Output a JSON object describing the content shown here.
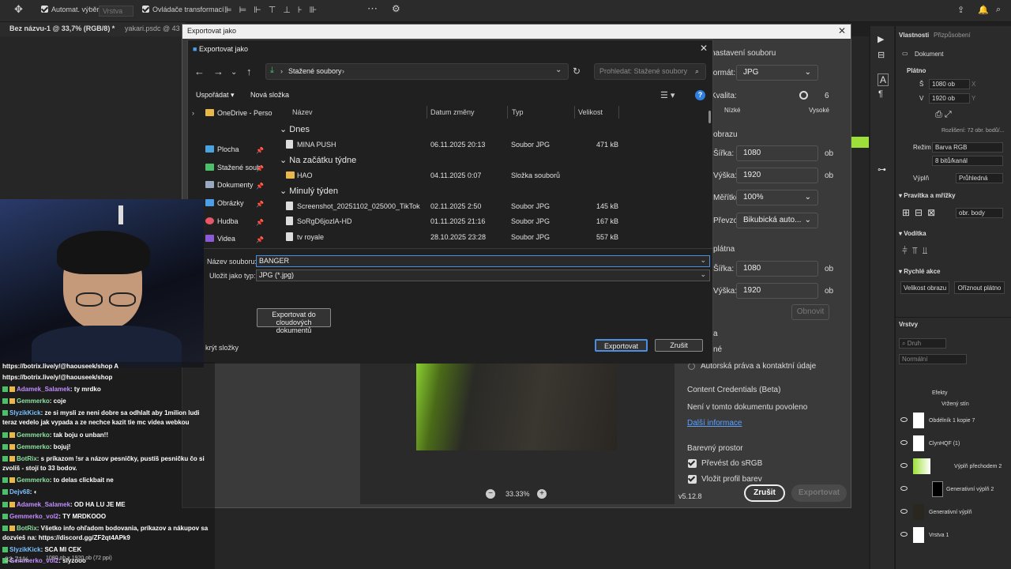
{
  "topbar": {
    "auto_select": "Automat. výběr",
    "layer_dropdown": "Vrstva",
    "transform_controls": "Ovládače transformací"
  },
  "tabs": [
    {
      "label": "Bez názvu-1 @ 33,7% (RGB/8) *"
    },
    {
      "label": "yakari.psdc @ 43"
    }
  ],
  "outer_dialog": {
    "title": "Exportovat jako",
    "file_settings_header": "nastavení souboru",
    "format_label": "formát:",
    "format_value": "JPG",
    "quality_label": "Kvalita:",
    "quality_value": "6",
    "quality_low": "Nízké",
    "quality_high": "Vysoké",
    "image_size_header": "obrazu",
    "width_label": "Šířka:",
    "width_value": "1080",
    "height_label": "Výška:",
    "height_value": "1920",
    "scale_label": "Měřítko:",
    "scale_value": "100%",
    "resample_label": "Převzorkovat:",
    "resample_value": "Bikubická auto...",
    "unit": "ob",
    "canvas_header": "plátna",
    "canvas_width_value": "1080",
    "canvas_height_value": "1920",
    "reset_button": "Obnovit",
    "metadata_partial_1": "a",
    "metadata_partial_2": "né",
    "copyright_label": "Autorská práva a kontaktní údaje",
    "content_credentials_title": "Content Credentials (Beta)",
    "content_credentials_text": "Není v tomto dokumentu povoleno",
    "more_info_link": "Další informace",
    "color_space_title": "Barevný prostor",
    "convert_srgb": "Převést do sRGB",
    "embed_profile": "Vložit profil barev",
    "version": "v5.12.8",
    "zoom": "33.33%",
    "cancel_button": "Zrušit",
    "export_button": "Exportovat"
  },
  "save_dialog": {
    "title": "Exportovat jako",
    "breadcrumb": "Stažené soubory",
    "search_placeholder": "Prohledat: Stažené soubory",
    "organize": "Uspořádat",
    "new_folder": "Nová složka",
    "nav": [
      {
        "label": "OneDrive - Perso",
        "color": "#e8b84a"
      },
      {
        "label": "Plocha",
        "color": "#4aa3df"
      },
      {
        "label": "Stažené soub",
        "color": "#4cbf6a"
      },
      {
        "label": "Dokumenty",
        "color": "#9aa8c0"
      },
      {
        "label": "Obrázky",
        "color": "#4a9fe8"
      },
      {
        "label": "Hudba",
        "color": "#e8566a"
      },
      {
        "label": "Videa",
        "color": "#8a5ad8"
      }
    ],
    "columns": {
      "name": "Název",
      "date": "Datum změny",
      "type": "Typ",
      "size": "Velikost"
    },
    "groups": [
      {
        "label": "Dnes"
      },
      {
        "label": "Na začátku týdne"
      },
      {
        "label": "Minulý týden"
      }
    ],
    "files": [
      {
        "name": "MINA PUSH",
        "date": "06.11.2025 20:13",
        "type": "Soubor JPG",
        "size": "471 kB"
      },
      {
        "name": "HAO",
        "date": "04.11.2025 0:07",
        "type": "Složka souborů",
        "size": ""
      },
      {
        "name": "Screenshot_20251102_025000_TikTok",
        "date": "02.11.2025 2:50",
        "type": "Soubor JPG",
        "size": "145 kB"
      },
      {
        "name": "SoRgD6jozlA-HD",
        "date": "01.11.2025 21:16",
        "type": "Soubor JPG",
        "size": "167 kB"
      },
      {
        "name": "tv royale",
        "date": "28.10.2025 23:28",
        "type": "Soubor JPG",
        "size": "557 kB"
      }
    ],
    "filename_label": "Název souboru:",
    "filename_value": "BANGER",
    "filetype_label": "Uložit jako typ:",
    "filetype_value": "JPG (*.jpg)",
    "cloud_button_line1": "Exportovat do",
    "cloud_button_line2": "cloudových dokumentů",
    "hide_folders": "krýt složky",
    "export_button": "Exportovat",
    "cancel_button": "Zrušit"
  },
  "right_panel": {
    "tab_properties": "Vlastnosti",
    "tab_adjustments": "Přizpůsobení",
    "document_label": "Dokument",
    "canvas_label": "Plátno",
    "w_label": "Š",
    "w_value": "1080 ob",
    "h_label": "V",
    "h_value": "1920 ob",
    "x_label": "X",
    "y_label": "Y",
    "resolution": "Rozlišení: 72 obr. bodů/...",
    "mode_label": "Režim",
    "mode_value": "Barva RGB",
    "bits_value": "8 bitů/kanál",
    "fill_label": "Výplň",
    "fill_value": "Průhledná",
    "rulers_label": "Pravítka a mřížky",
    "units_value": "obr. body",
    "guides_label": "Vodítka",
    "quick_actions_label": "Rychlé akce",
    "image_size_btn": "Velikost obrazu",
    "crop_btn": "Oříznout plátno",
    "layers_tab": "Vrstvy",
    "search_kind": "Druh",
    "blend_mode": "Normální",
    "effects": "Efekty",
    "inner_shadow": "Vržený stín",
    "layers": [
      {
        "name": "Obdélník 1 kopie 7"
      },
      {
        "name": "ClynHQF (1)"
      },
      {
        "name": "Výplň přechodem 2"
      },
      {
        "name": "Generativní výplň 2"
      },
      {
        "name": "Generativní výplň"
      },
      {
        "name": "Vrstva 1"
      }
    ]
  },
  "status_bar": {
    "zoom": "33,71%",
    "info": "1080 ob x 1920 ob (72 ppi)"
  },
  "chat": [
    {
      "user": "",
      "text": "https://botrix.live/y/@haouseek/shop A"
    },
    {
      "user": "",
      "text": "https://botrix.live/y/@haouseek/shop"
    },
    {
      "user": "Adamek_Salamek",
      "text": ": ty mrdko"
    },
    {
      "user": "Gemmerko",
      "text": ": coje"
    },
    {
      "user": "SlyzikKick",
      "text": ": ze si mysli ze neni dobre sa odhlalt aby 1milion ludi"
    },
    {
      "user": "",
      "text": "teraz vedelo jak vypada a ze nechce kazit tie mc videa webkou"
    },
    {
      "user": "Gemmerko",
      "text": ": tak boju o unban!!"
    },
    {
      "user": "Gemmerko",
      "text": ": bojuj!"
    },
    {
      "user": "BotRix",
      "text": ": s príkazom !sr a názov pesničky, pustíš pesničku čo si"
    },
    {
      "user": "",
      "text": "zvolíš - stojí to 33 bodov."
    },
    {
      "user": "Gemmerko",
      "text": ": to delas clickbait ne"
    },
    {
      "user": "Dejv68",
      "text": ":"
    },
    {
      "user": "Adamek_Salamek",
      "text": ": OD HA LU JE ME"
    },
    {
      "user": "Gemmerko_vol2",
      "text": ": TY MRDKOOO"
    },
    {
      "user": "BotRix",
      "text": ": Všetko info ohľadom bodovania, príkazov a nákupov sa"
    },
    {
      "user": "",
      "text": "dozvieš na: https://discord.gg/ZF2qt4APk9"
    },
    {
      "user": "SlyzikKick",
      "text": ": SCA MI CEK"
    },
    {
      "user": "Gemmerko_vol2",
      "text": ": slyzooo"
    }
  ]
}
